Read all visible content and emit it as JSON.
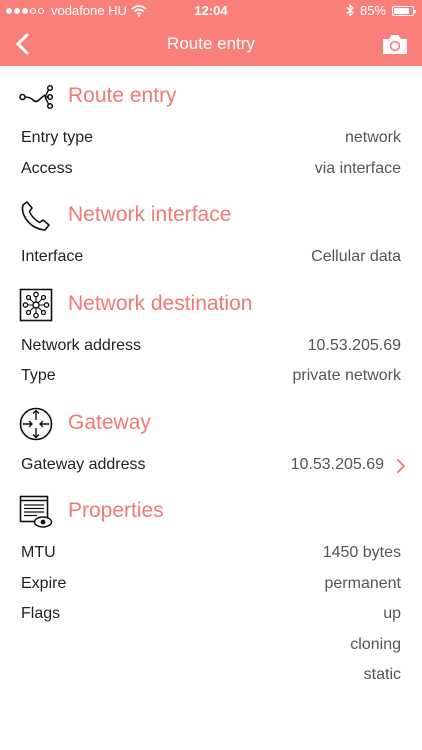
{
  "status": {
    "carrier": "vodafone HU",
    "time": "12:04",
    "battery": "85%",
    "battery_level": 0.85
  },
  "nav": {
    "title": "Route entry"
  },
  "route": {
    "title": "Route entry",
    "rows": [
      {
        "label": "Entry type",
        "value": "network"
      },
      {
        "label": "Access",
        "value": "via interface"
      }
    ]
  },
  "interface": {
    "title": "Network interface",
    "rows": [
      {
        "label": "Interface",
        "value": "Cellular data"
      }
    ]
  },
  "destination": {
    "title": "Network destination",
    "rows": [
      {
        "label": "Network address",
        "value": "10.53.205.69"
      },
      {
        "label": "Type",
        "value": "private network"
      }
    ]
  },
  "gateway": {
    "title": "Gateway",
    "rows": [
      {
        "label": "Gateway address",
        "value": "10.53.205.69"
      }
    ]
  },
  "properties": {
    "title": "Properties",
    "rows": [
      {
        "label": "MTU",
        "value": "1450 bytes"
      },
      {
        "label": "Expire",
        "value": "permanent"
      },
      {
        "label": "Flags",
        "value": "up"
      },
      {
        "label": "",
        "value": "cloning"
      },
      {
        "label": "",
        "value": "static"
      }
    ]
  },
  "icons": {
    "back": "chevron-left-icon",
    "camera": "camera-icon",
    "route": "route-icon",
    "interface": "phone-icon",
    "destination": "network-icon",
    "gateway": "router-icon",
    "properties": "document-eye-icon",
    "chevron": "chevron-right-icon"
  },
  "colors": {
    "accent": "#f9807a",
    "section_title": "#f07a75"
  }
}
